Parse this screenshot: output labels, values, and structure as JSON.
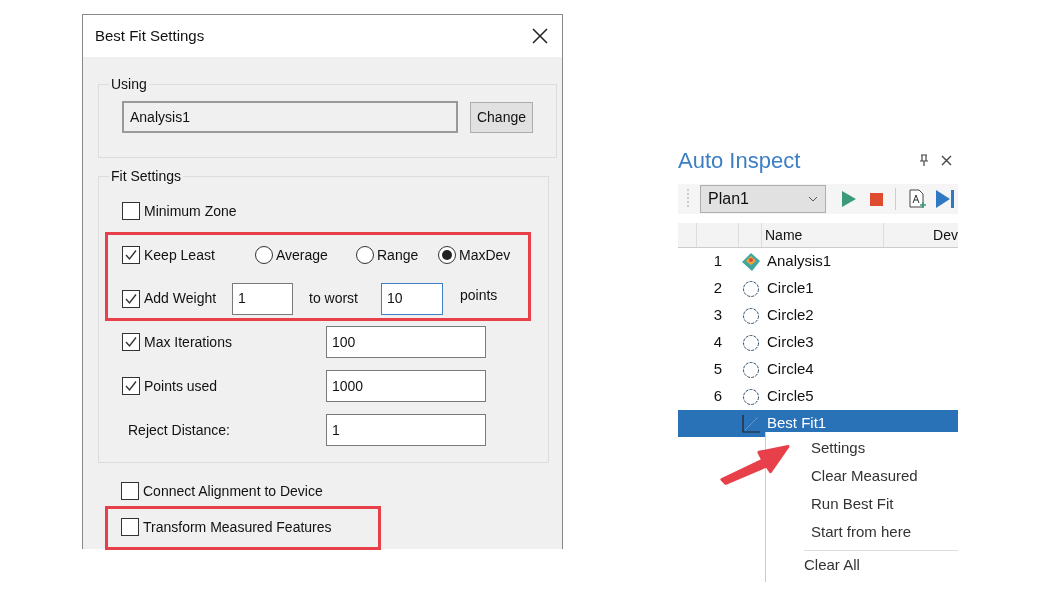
{
  "dialog": {
    "title": "Best Fit Settings",
    "using": {
      "legend": "Using",
      "value": "Analysis1",
      "button": "Change"
    },
    "fit_settings": {
      "legend": "Fit Settings",
      "rows": [
        {
          "kind": "checkbox",
          "label": "Minimum Zone",
          "checked": false
        },
        {
          "kind": "checkbox_radios",
          "label": "Keep Least",
          "checked": true,
          "options": [
            {
              "label": "Average",
              "selected": false
            },
            {
              "label": "Range",
              "selected": false
            },
            {
              "label": "MaxDev",
              "selected": true
            }
          ]
        },
        {
          "kind": "weight",
          "label": "Add Weight",
          "checked": true,
          "fields": [
            {
              "value": "1",
              "focused": false
            },
            {
              "value": "10",
              "focused": true
            }
          ],
          "middle": "to worst",
          "suffix": "points"
        },
        {
          "kind": "checkbox_field",
          "label": "Max Iterations",
          "checked": true,
          "value": "100"
        },
        {
          "kind": "checkbox_field",
          "label": "Points used",
          "checked": true,
          "value": "1000"
        },
        {
          "kind": "label_field",
          "label": "Reject Distance:",
          "value": "1"
        }
      ]
    },
    "options": [
      {
        "label": "Connect Alignment to Device",
        "checked": false
      },
      {
        "label": "Transform Measured Features",
        "checked": false
      }
    ]
  },
  "panel": {
    "title": "Auto Inspect",
    "plan": "Plan1",
    "columns": [
      "Name",
      "Dev"
    ],
    "rows": [
      {
        "number": "1",
        "name": "Analysis1",
        "kind": "analysis",
        "selected": false
      },
      {
        "number": "2",
        "name": "Circle1",
        "kind": "circle",
        "selected": false
      },
      {
        "number": "3",
        "name": "Circle2",
        "kind": "circle",
        "selected": false
      },
      {
        "number": "4",
        "name": "Circle3",
        "kind": "circle",
        "selected": false
      },
      {
        "number": "5",
        "name": "Circle4",
        "kind": "circle",
        "selected": false
      },
      {
        "number": "6",
        "name": "Circle5",
        "kind": "circle",
        "selected": false
      },
      {
        "name": "Best Fit1",
        "kind": "bestfit",
        "selected": true
      }
    ],
    "context_menu": {
      "groups": [
        [
          "Settings",
          "Clear Measured",
          "Run Best Fit",
          "Start from here"
        ],
        [
          "Clear All"
        ]
      ]
    }
  }
}
